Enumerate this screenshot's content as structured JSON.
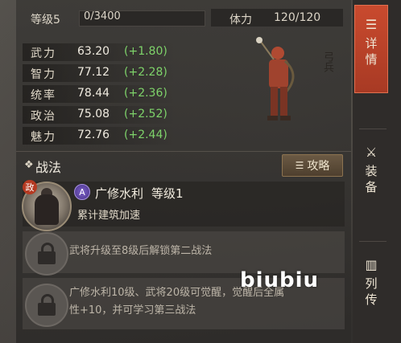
{
  "header": {
    "level_label": "等级5",
    "exp_text": "0/3400",
    "exp_progress": 0,
    "stamina_label": "体力",
    "stamina_value": "120/120"
  },
  "stats": [
    {
      "name": "武力",
      "value": "63.20",
      "inc": "(+1.80)"
    },
    {
      "name": "智力",
      "value": "77.12",
      "inc": "(+2.28)"
    },
    {
      "name": "统率",
      "value": "78.44",
      "inc": "(+2.36)"
    },
    {
      "name": "政治",
      "value": "75.08",
      "inc": "(+2.52)"
    },
    {
      "name": "魅力",
      "value": "72.76",
      "inc": "(+2.44)"
    }
  ],
  "unit_type": "弓兵",
  "tactics": {
    "title": "战法",
    "strategy_button": "攻略",
    "skill": {
      "badge": "政",
      "grade": "A",
      "name": "广修水利",
      "level": "等级1",
      "desc": "累计建筑加速"
    },
    "locked_1": "武将升级至8级后解锁第二战法",
    "locked_2_line1": "广修水利10级、武将20级可觉醒，觉醒后全属",
    "locked_2_line2": "性+10，并可学习第三战法"
  },
  "tabs": [
    {
      "label_1": "详",
      "label_2": "情",
      "icon": "scroll-icon",
      "active": true
    },
    {
      "label_1": "装",
      "label_2": "备",
      "icon": "equipment-icon",
      "active": false
    },
    {
      "label_1": "列",
      "label_2": "传",
      "icon": "book-icon",
      "active": false
    }
  ],
  "watermark": "biubiu",
  "colors": {
    "increase": "#7ed36a",
    "active_tab": "#c94a2e",
    "grade_a": "#6a52b8"
  }
}
